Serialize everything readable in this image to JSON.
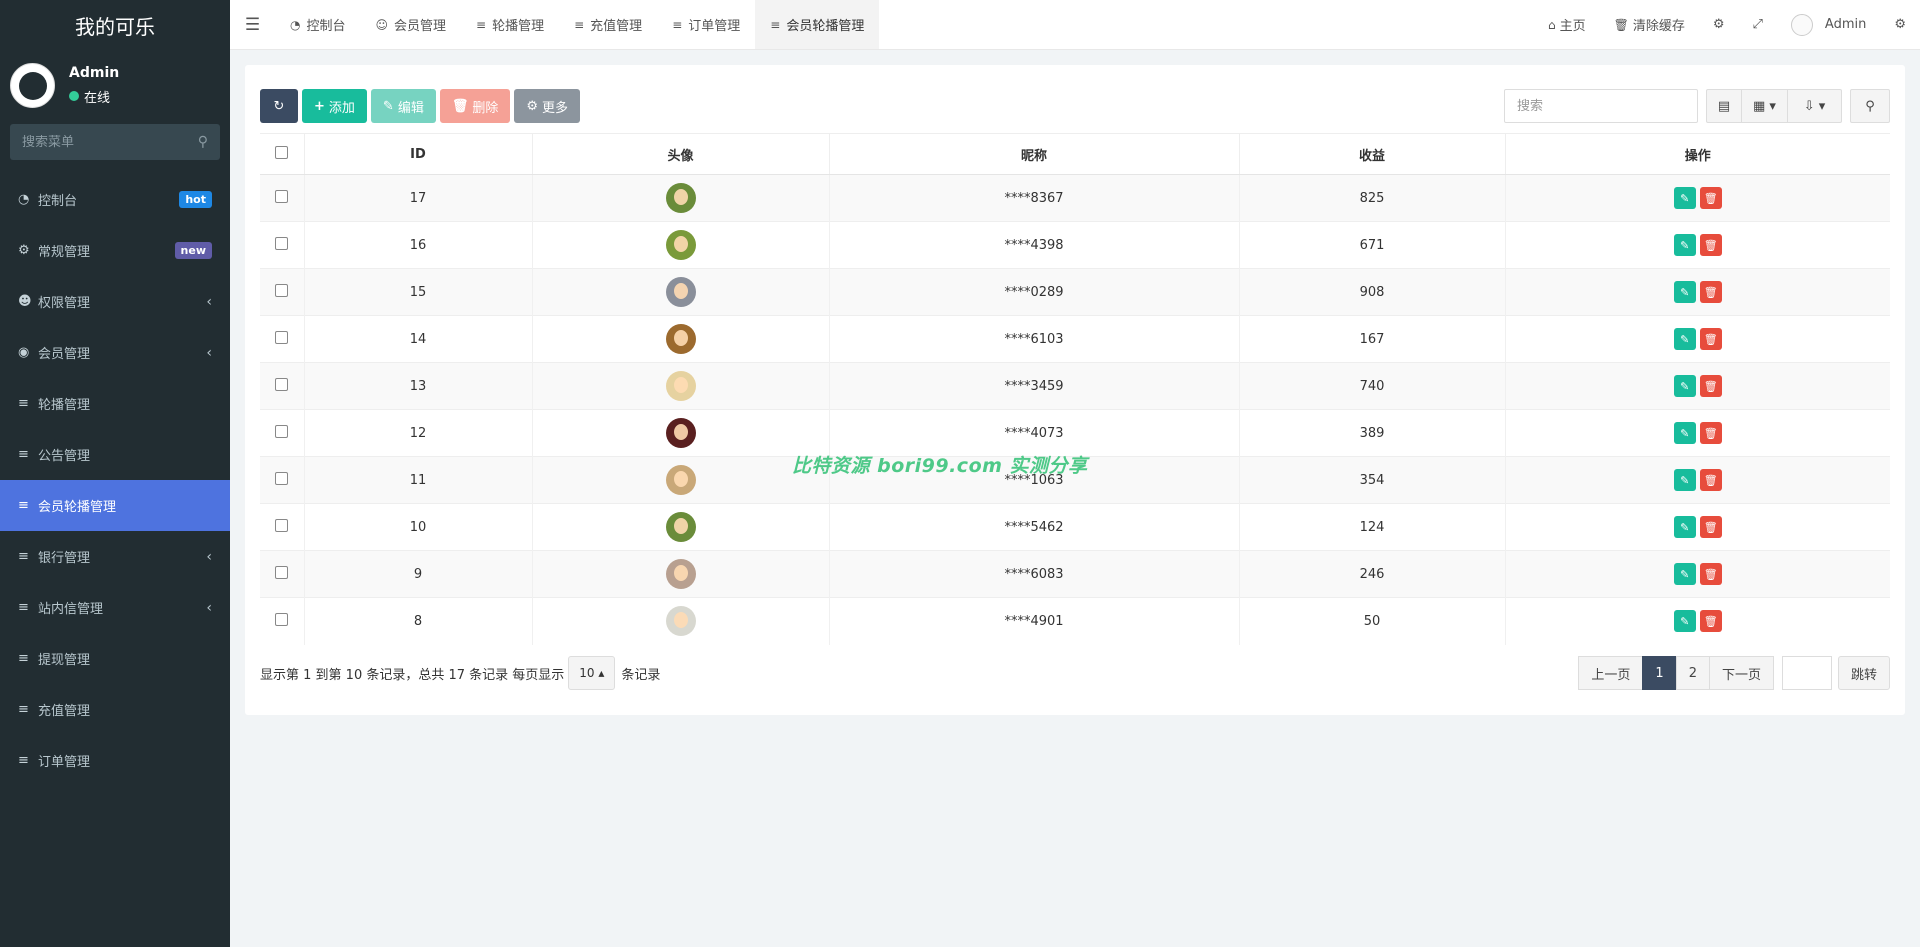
{
  "brand": "我的可乐",
  "user": {
    "name": "Admin",
    "status": "在线"
  },
  "side_search": {
    "placeholder": "搜索菜单"
  },
  "menu": [
    {
      "label": "控制台",
      "icon": "dashboard-icon",
      "badge": "hot"
    },
    {
      "label": "常规管理",
      "icon": "cogs-icon",
      "badge": "new"
    },
    {
      "label": "权限管理",
      "icon": "group-icon",
      "chevron": true
    },
    {
      "label": "会员管理",
      "icon": "user-circle-icon",
      "chevron": true
    },
    {
      "label": "轮播管理",
      "icon": "list-icon"
    },
    {
      "label": "公告管理",
      "icon": "list-icon"
    },
    {
      "label": "会员轮播管理",
      "icon": "list-icon",
      "active": true
    },
    {
      "label": "银行管理",
      "icon": "list-icon",
      "chevron": true
    },
    {
      "label": "站内信管理",
      "icon": "list-icon",
      "chevron": true
    },
    {
      "label": "提现管理",
      "icon": "list-icon"
    },
    {
      "label": "充值管理",
      "icon": "list-icon"
    },
    {
      "label": "订单管理",
      "icon": "list-icon"
    }
  ],
  "tabs": [
    {
      "label": "控制台",
      "icon": "dashboard-icon"
    },
    {
      "label": "会员管理",
      "icon": "user-icon"
    },
    {
      "label": "轮播管理",
      "icon": "list-icon"
    },
    {
      "label": "充值管理",
      "icon": "list-icon"
    },
    {
      "label": "订单管理",
      "icon": "list-icon"
    },
    {
      "label": "会员轮播管理",
      "icon": "list-icon",
      "active": true
    }
  ],
  "header_right": {
    "home": "主页",
    "clear_cache": "清除缓存",
    "admin": "Admin"
  },
  "toolbar": {
    "add": "添加",
    "edit": "编辑",
    "delete": "删除",
    "more": "更多"
  },
  "search": {
    "placeholder": "搜索"
  },
  "table": {
    "columns": [
      "ID",
      "头像",
      "昵称",
      "收益",
      "操作"
    ],
    "rows": [
      {
        "id": "17",
        "nickname": "****8367",
        "income": "825",
        "avatar_color": "#6a8c3a"
      },
      {
        "id": "16",
        "nickname": "****4398",
        "income": "671",
        "avatar_color": "#7a9a3a"
      },
      {
        "id": "15",
        "nickname": "****0289",
        "income": "908",
        "avatar_color": "#8a8f9a"
      },
      {
        "id": "14",
        "nickname": "****6103",
        "income": "167",
        "avatar_color": "#9c6a2e"
      },
      {
        "id": "13",
        "nickname": "****3459",
        "income": "740",
        "avatar_color": "#e6d2a0"
      },
      {
        "id": "12",
        "nickname": "****4073",
        "income": "389",
        "avatar_color": "#5a2020"
      },
      {
        "id": "11",
        "nickname": "****1063",
        "income": "354",
        "avatar_color": "#c9a878"
      },
      {
        "id": "10",
        "nickname": "****5462",
        "income": "124",
        "avatar_color": "#6a8c3a"
      },
      {
        "id": "9",
        "nickname": "****6083",
        "income": "246",
        "avatar_color": "#b8a090"
      },
      {
        "id": "8",
        "nickname": "****4901",
        "income": "50",
        "avatar_color": "#d8d8d0"
      }
    ]
  },
  "pagination": {
    "info_prefix": "显示第 1 到第 10 条记录，总共 17 条记录 每页显示",
    "page_size": "10",
    "info_suffix": "条记录",
    "prev": "上一页",
    "pages": [
      "1",
      "2"
    ],
    "next": "下一页",
    "jump": "跳转"
  },
  "watermark": "比特资源 bori99.com 实测分享",
  "colors": {
    "sidebar_bg": "#222d32",
    "active_menu": "#4e73df",
    "primary": "#18bc9c",
    "danger": "#e74c3c",
    "dark": "#3b4b62"
  }
}
